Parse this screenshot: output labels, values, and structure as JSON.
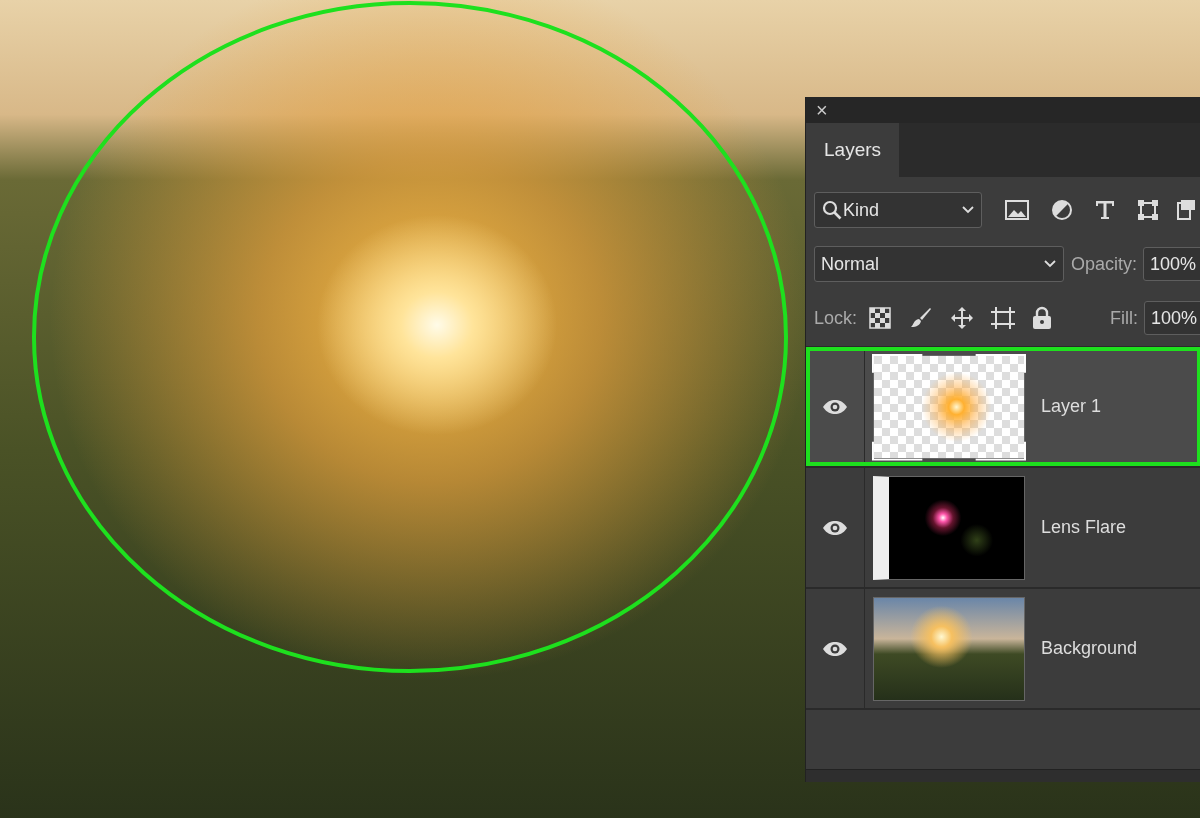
{
  "panel": {
    "close": "×",
    "tab": {
      "label": "Layers",
      "selected": true
    },
    "filter": {
      "value": "Kind"
    },
    "blend_mode": {
      "value": "Normal"
    },
    "opacity": {
      "label": "Opacity:",
      "value": "100%"
    },
    "lock": {
      "label": "Lock:"
    },
    "fill": {
      "label": "Fill:",
      "value": "100%"
    },
    "layers": [
      {
        "name": "Layer 1",
        "visible": true,
        "selected": true,
        "highlighted": true,
        "kind": "glow"
      },
      {
        "name": "Lens Flare",
        "visible": true,
        "selected": false,
        "highlighted": false,
        "kind": "flare"
      },
      {
        "name": "Background",
        "visible": true,
        "selected": false,
        "highlighted": false,
        "kind": "photo"
      }
    ]
  }
}
